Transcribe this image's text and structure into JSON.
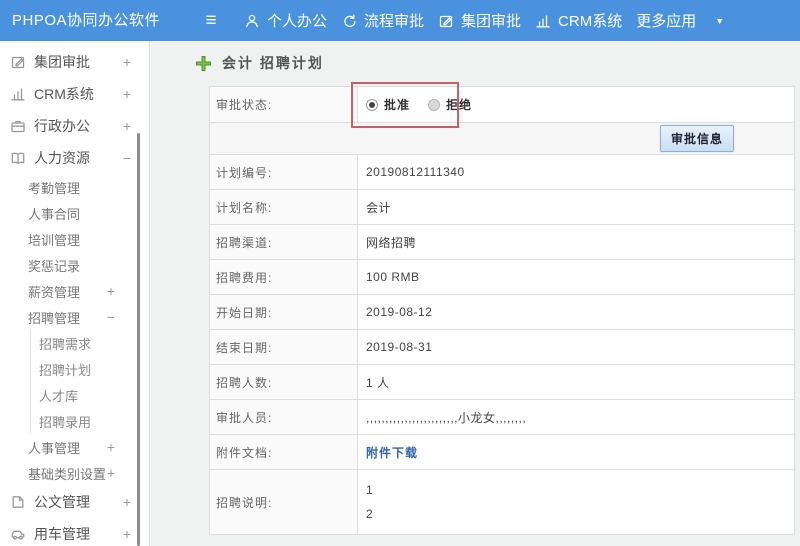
{
  "topbar": {
    "title": "PHPOA协同办公软件",
    "hamburger_icon": "menu-icon",
    "nav": [
      {
        "icon": "person-icon",
        "label": "个人办公"
      },
      {
        "icon": "process-icon",
        "label": "流程审批"
      },
      {
        "icon": "edit-square-icon",
        "label": "集团审批"
      },
      {
        "icon": "bar-chart-icon",
        "label": "CRM系统"
      },
      {
        "icon": "caret-down-icon",
        "label": "更多应用",
        "caret": true
      }
    ],
    "color": "#4a92de"
  },
  "sidebar": {
    "items": [
      {
        "icon": "edit-square-icon",
        "label": "集团审批",
        "toggle": "+",
        "level": 0
      },
      {
        "icon": "bar-chart-icon",
        "label": "CRM系统",
        "toggle": "+",
        "level": 0
      },
      {
        "icon": "briefcase-icon",
        "label": "行政办公",
        "toggle": "+",
        "level": 0
      },
      {
        "icon": "book-icon",
        "label": "人力资源",
        "toggle": "−",
        "level": 0
      },
      {
        "label": "考勤管理",
        "level": 1
      },
      {
        "label": "人事合同",
        "level": 1
      },
      {
        "label": "培训管理",
        "level": 1
      },
      {
        "label": "奖惩记录",
        "level": 1
      },
      {
        "label": "薪资管理",
        "toggle": "+",
        "level": 1
      },
      {
        "label": "招聘管理",
        "toggle": "−",
        "level": 1
      },
      {
        "label": "招聘需求",
        "level": 2
      },
      {
        "label": "招聘计划",
        "level": 2
      },
      {
        "label": "人才库",
        "level": 2
      },
      {
        "label": "招聘录用",
        "level": 2
      },
      {
        "label": "人事管理",
        "toggle": "+",
        "level": 1
      },
      {
        "label": "基础类别设置",
        "toggle": "+",
        "level": 1
      },
      {
        "icon": "document-icon",
        "label": "公文管理",
        "toggle": "+",
        "level": 0
      },
      {
        "icon": "car-icon",
        "label": "用车管理",
        "toggle": "+",
        "level": 0
      }
    ]
  },
  "main": {
    "breadcrumb": "会计 招聘计划",
    "plus_icon": "add-icon",
    "status_row": {
      "label": "审批状态:",
      "options": [
        {
          "label": "批准",
          "selected": true
        },
        {
          "label": "拒绝",
          "selected": false
        }
      ]
    },
    "approve_button": "审批信息",
    "rows": [
      {
        "label": "计划编号:",
        "value": "20190812111340"
      },
      {
        "label": "计划名称:",
        "value": "会计"
      },
      {
        "label": "招聘渠道:",
        "value": "网络招聘"
      },
      {
        "label": "招聘费用:",
        "value": "100 RMB"
      },
      {
        "label": "开始日期:",
        "value": "2019-08-12"
      },
      {
        "label": "结束日期:",
        "value": "2019-08-31"
      },
      {
        "label": "招聘人数:",
        "value": "1 人"
      },
      {
        "label": "审批人员:",
        "value": ",,,,,,,,,,,,,,,,,,,,,,,,小龙女,,,,,,,,"
      },
      {
        "label": "附件文档:",
        "value": "附件下载",
        "type": "link"
      },
      {
        "label": "招聘说明:",
        "value": [
          "1",
          "2"
        ],
        "type": "multiline"
      }
    ],
    "annotation_color": "#c4606e"
  }
}
